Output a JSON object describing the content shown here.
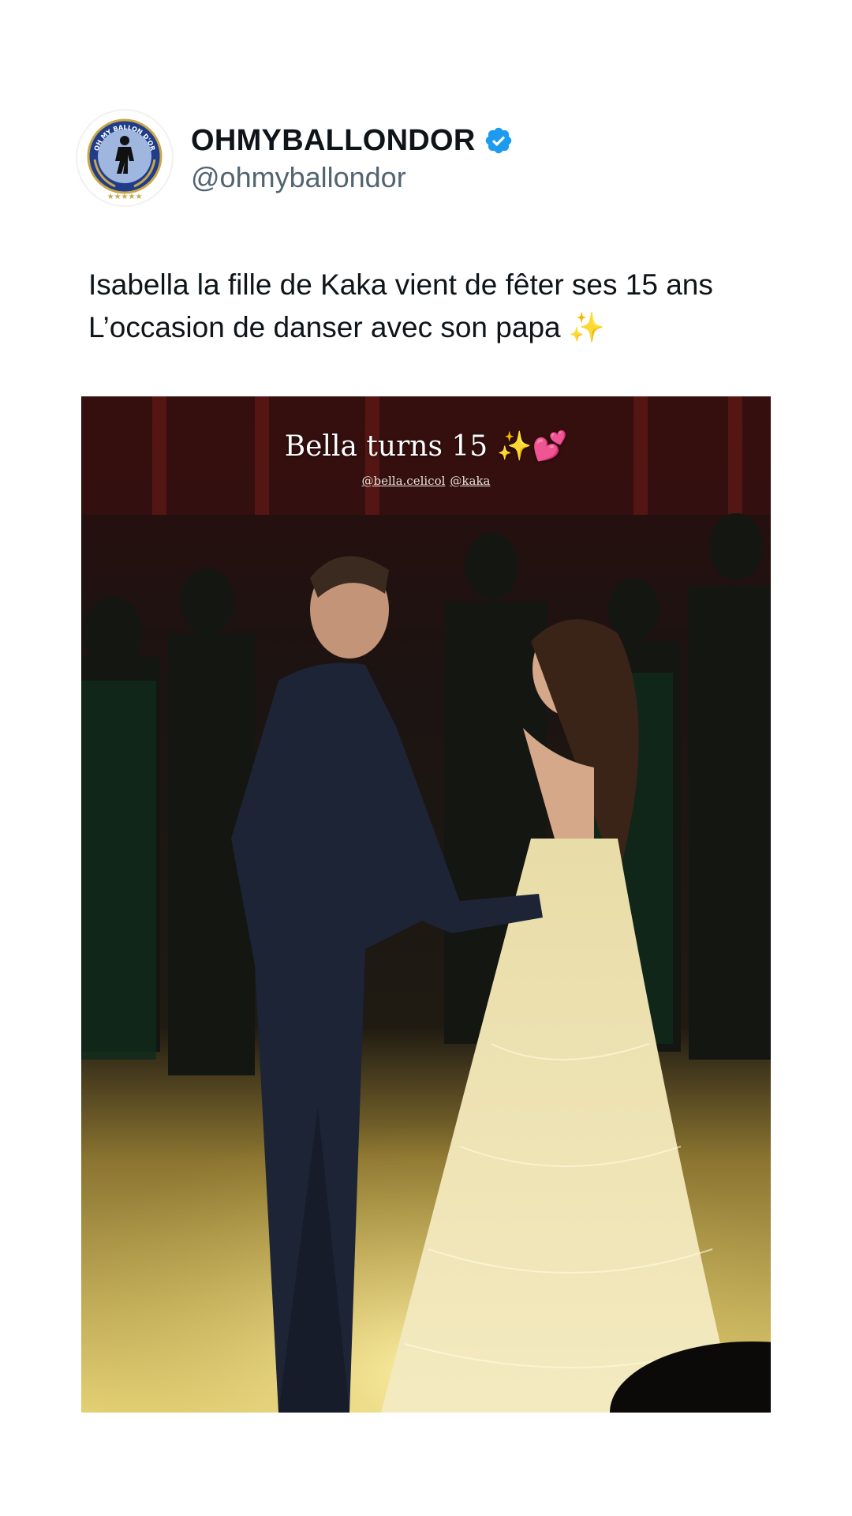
{
  "post": {
    "author": {
      "display_name": "OHMYBALLONDOR",
      "handle": "@ohmyballondor",
      "verified": true,
      "avatar_icon": "ballon-dor-badge-icon",
      "avatar_text": "OH MY BALLON D'OR"
    },
    "text_lines": [
      "Isabella la fille de Kaka vient de fêter ses 15 ans",
      "L’occasion de danser avec son papa ✨"
    ],
    "media": {
      "type": "video-still",
      "overlay_title": "Bella turns 15 ✨💕",
      "overlay_tags": [
        "@bella.celicol",
        "@kaka"
      ]
    }
  },
  "colors": {
    "text": "#0f1419",
    "secondary": "#536471",
    "verified": "#1d9bf0",
    "background": "#ffffff"
  }
}
